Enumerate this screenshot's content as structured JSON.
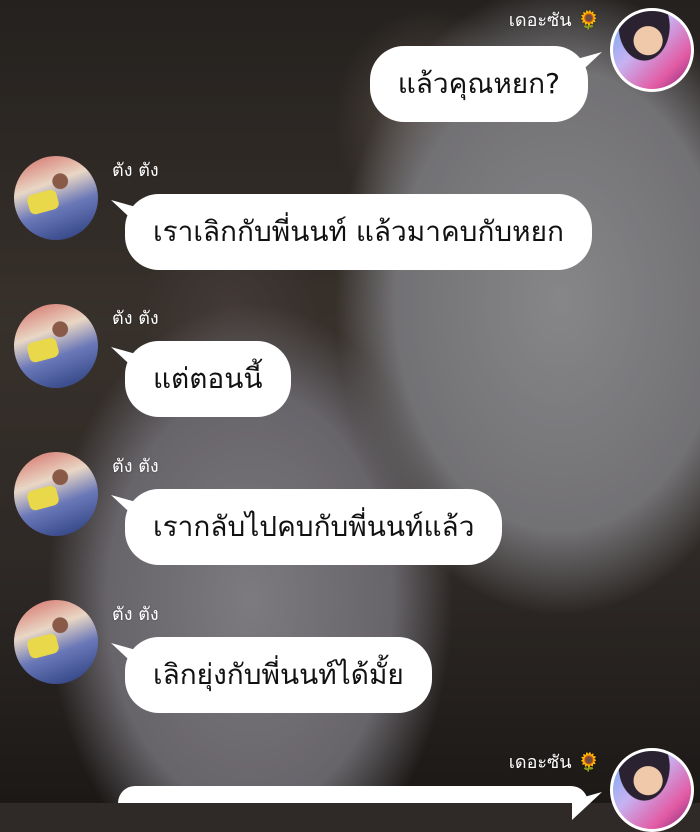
{
  "messages": [
    {
      "sender": "เดอะซัน",
      "sender_icon": "sunflower-icon",
      "side": "right",
      "text": "แล้วคุณหยก?"
    },
    {
      "sender": "ตัง ตัง",
      "side": "left",
      "text": "เราเลิกกับพี่นนท์ แล้วมาคบกับหยก"
    },
    {
      "sender": "ตัง ตัง",
      "side": "left",
      "text": "แต่ตอนนี้"
    },
    {
      "sender": "ตัง ตัง",
      "side": "left",
      "text": "เรากลับไปคบกับพี่นนท์แล้ว"
    },
    {
      "sender": "ตัง ตัง",
      "side": "left",
      "text": "เลิกยุ่งกับพี่นนท์ได้มั้ย"
    },
    {
      "sender": "เดอะซัน",
      "sender_icon": "sunflower-icon",
      "side": "right",
      "text": ""
    }
  ]
}
